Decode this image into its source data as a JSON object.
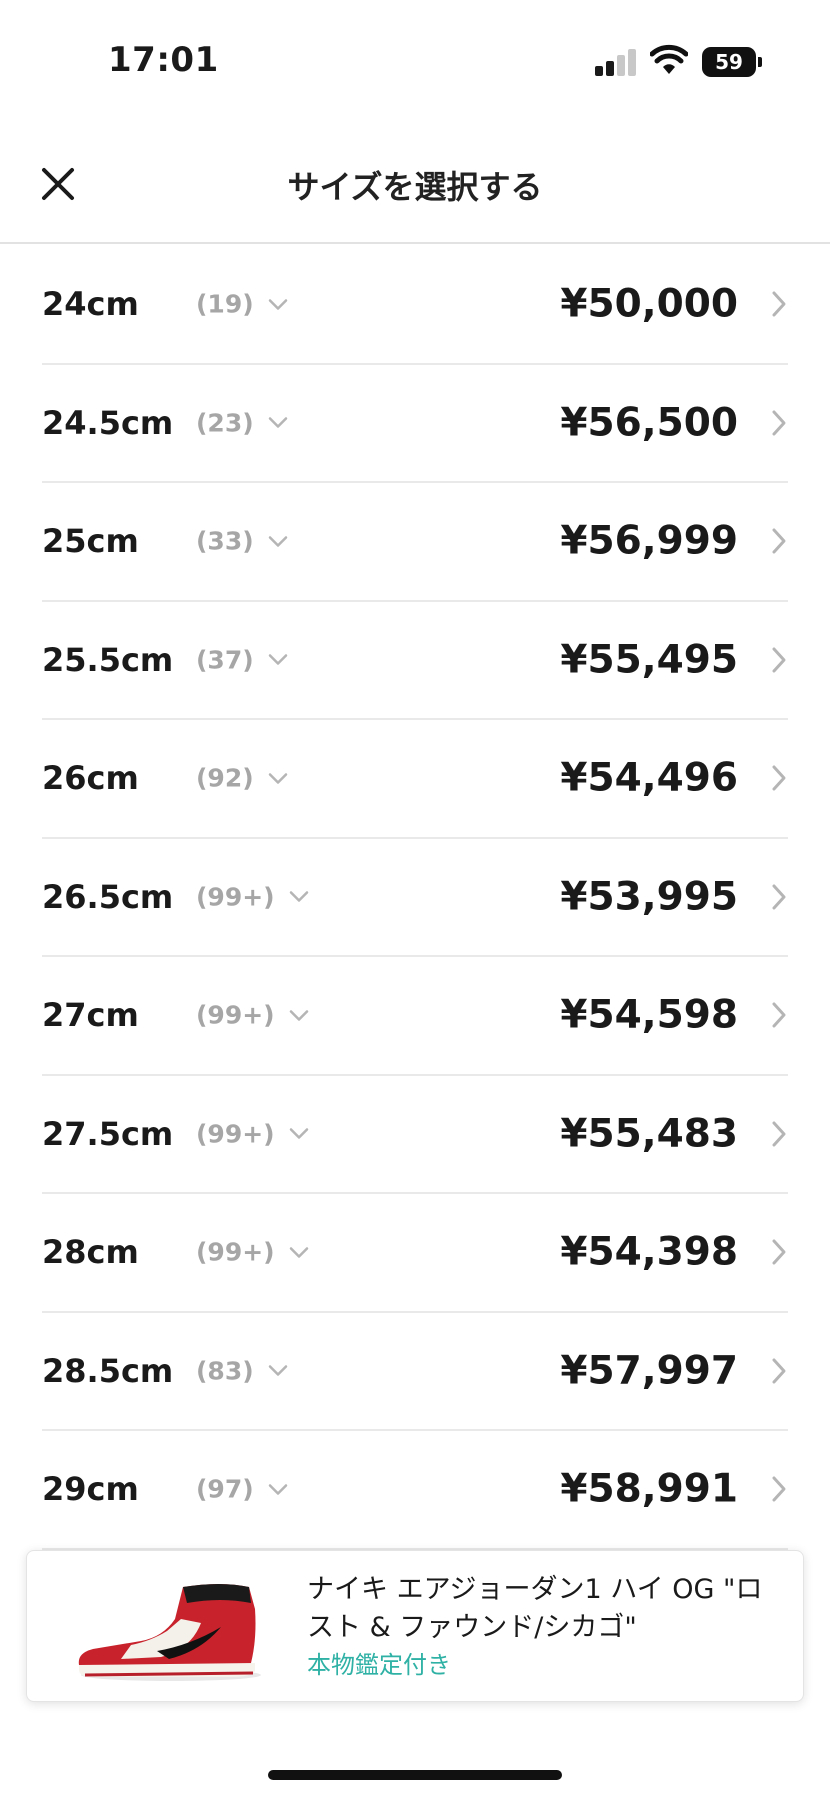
{
  "status_bar": {
    "time": "17:01",
    "battery": "59"
  },
  "header": {
    "title": "サイズを選択する",
    "close_icon": "close-icon"
  },
  "sizes": [
    {
      "size": "24cm",
      "count": "(19)",
      "price": "¥50,000"
    },
    {
      "size": "24.5cm",
      "count": "(23)",
      "price": "¥56,500"
    },
    {
      "size": "25cm",
      "count": "(33)",
      "price": "¥56,999"
    },
    {
      "size": "25.5cm",
      "count": "(37)",
      "price": "¥55,495"
    },
    {
      "size": "26cm",
      "count": "(92)",
      "price": "¥54,496"
    },
    {
      "size": "26.5cm",
      "count": "(99+)",
      "price": "¥53,995"
    },
    {
      "size": "27cm",
      "count": "(99+)",
      "price": "¥54,598"
    },
    {
      "size": "27.5cm",
      "count": "(99+)",
      "price": "¥55,483"
    },
    {
      "size": "28cm",
      "count": "(99+)",
      "price": "¥54,398"
    },
    {
      "size": "28.5cm",
      "count": "(83)",
      "price": "¥57,997"
    },
    {
      "size": "29cm",
      "count": "(97)",
      "price": "¥58,991"
    }
  ],
  "product": {
    "name": "ナイキ エアジョーダン1 ハイ OG \"ロスト & ファウンド/シカゴ\"",
    "tag": "本物鑑定付き",
    "image_icon": "sneaker-image"
  },
  "colors": {
    "accent": "#2fb1a5",
    "text": "#1a1a1a",
    "muted": "#a6a6a6",
    "divider": "#e9e9e9"
  }
}
